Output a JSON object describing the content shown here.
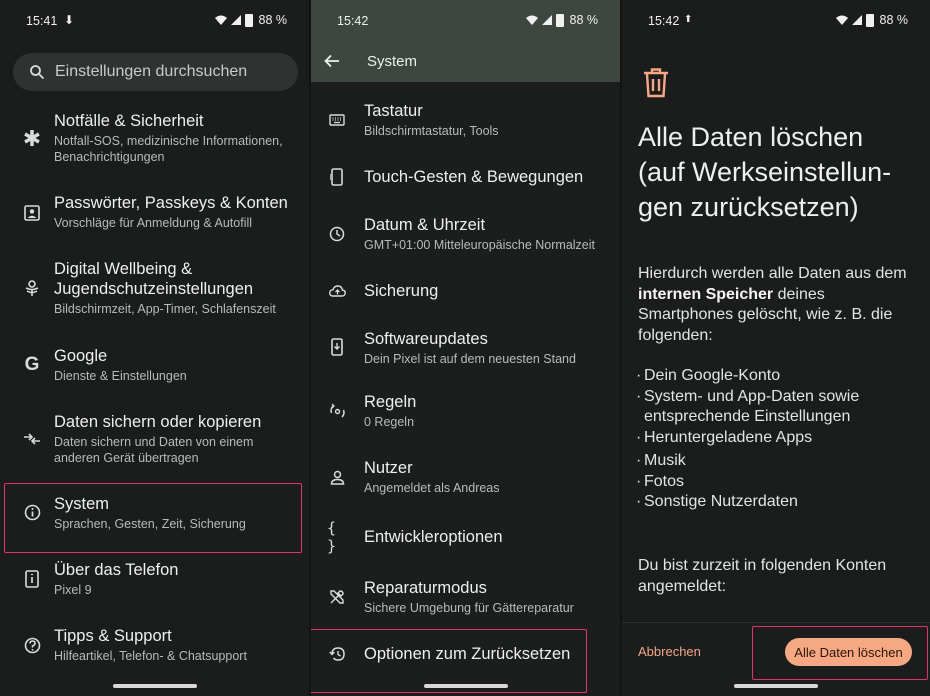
{
  "panel1": {
    "status": {
      "time": "15:41",
      "extra": "⬇",
      "battery": "88 %"
    },
    "search": {
      "placeholder": "Einstellungen durchsuchen"
    },
    "items": [
      {
        "title": "Notfälle & Sicherheit",
        "sub": "Notfall-SOS, medizinische Informationen, Benachrichtigungen",
        "icon": "asterisk-icon"
      },
      {
        "title": "Passwörter, Passkeys & Konten",
        "sub": "Vorschläge für Anmeldung & Autofill",
        "icon": "account-box-icon"
      },
      {
        "title": "Digital Wellbeing & Jugendschutzeinstellungen",
        "sub": "Bildschirmzeit, App-Timer, Schlafenszeit",
        "icon": "wellbeing-icon"
      },
      {
        "title": "Google",
        "sub": "Dienste & Einstellungen",
        "icon": "google-icon"
      },
      {
        "title": "Daten sichern oder kopieren",
        "sub": "Daten sichern und Daten von einem anderen Gerät übertragen",
        "icon": "transfer-icon"
      },
      {
        "title": "System",
        "sub": "Sprachen, Gesten, Zeit, Sicherung",
        "icon": "info-icon"
      },
      {
        "title": "Über das Telefon",
        "sub": "Pixel 9",
        "icon": "phone-info-icon"
      },
      {
        "title": "Tipps & Support",
        "sub": "Hilfeartikel, Telefon- & Chatsupport",
        "icon": "help-icon"
      }
    ]
  },
  "panel2": {
    "status": {
      "time": "15:42",
      "battery": "88 %"
    },
    "appbar": {
      "title": "System"
    },
    "items": [
      {
        "title": "Tastatur",
        "sub": "Bildschirmtastatur, Tools",
        "icon": "keyboard-icon"
      },
      {
        "title": "Touch-Gesten & Bewegungen",
        "sub": "",
        "icon": "gesture-phone-icon"
      },
      {
        "title": "Datum & Uhrzeit",
        "sub": "GMT+01:00 Mitteleuropäische Normalzeit",
        "icon": "clock-icon"
      },
      {
        "title": "Sicherung",
        "sub": "",
        "icon": "cloud-upload-icon"
      },
      {
        "title": "Softwareupdates",
        "sub": "Dein Pixel ist auf dem neuesten Stand",
        "icon": "system-update-icon"
      },
      {
        "title": "Regeln",
        "sub": "0 Regeln",
        "icon": "rules-icon"
      },
      {
        "title": "Nutzer",
        "sub": "Angemeldet als Andreas",
        "icon": "person-icon"
      },
      {
        "title": "Entwickleroptionen",
        "sub": "",
        "icon": "braces-icon"
      },
      {
        "title": "Reparaturmodus",
        "sub": "Sichere Umgebung für Gättereparatur",
        "icon": "tools-icon"
      },
      {
        "title": "Optionen zum Zurücksetzen",
        "sub": "",
        "icon": "history-icon"
      }
    ]
  },
  "panel3": {
    "status": {
      "time": "15:42",
      "battery": "88 %"
    },
    "title": "Alle Daten löschen (auf Werkseinstellun-gen zurücksetzen)",
    "title_lines": [
      "Alle Daten löschen",
      "(auf Werkseinstellun-",
      "gen zurücksetzen)"
    ],
    "para1_pre": "Hierdurch werden alle Daten aus dem ",
    "para1_bold": "internen Speicher",
    "para1_post": " deines Smartphones gelöscht, wie z. B. die folgenden:",
    "bullets": [
      "Dein Google-Konto",
      "System- und App-Daten sowie entsprechende Einstellungen",
      "Heruntergeladene Apps",
      "Musik",
      "Fotos",
      "Sonstige Nutzerdaten"
    ],
    "para2": "Du bist zurzeit in folgenden Konten angemeldet:",
    "cancel_label": "Abbrechen",
    "confirm_label": "Alle Daten löschen"
  },
  "colors": {
    "highlight": "#e0336f",
    "accent": "#f6a882",
    "appbar": "#3d4740"
  }
}
